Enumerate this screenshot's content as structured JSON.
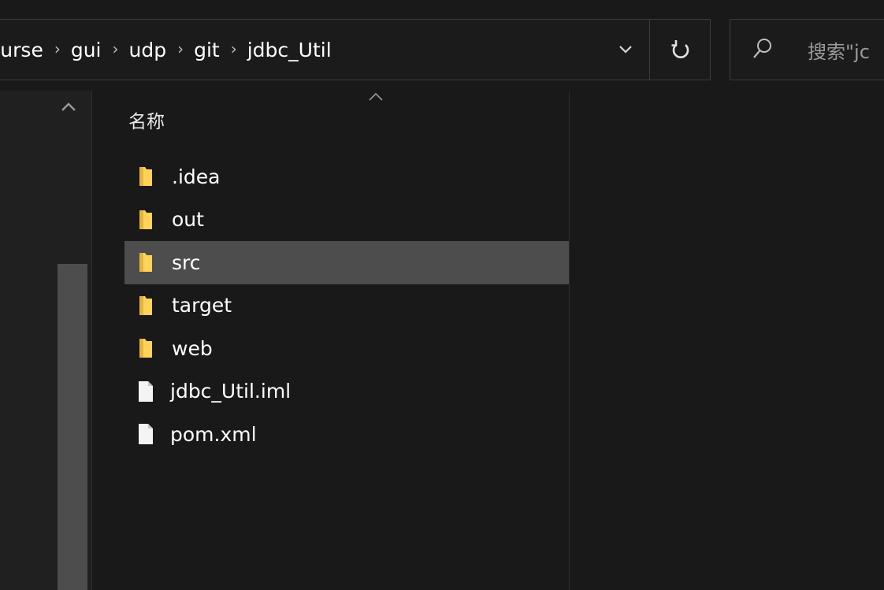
{
  "address_bar": {
    "breadcrumbs": [
      "ourse",
      "gui",
      "udp",
      "git",
      "jdbc_Util"
    ],
    "dropdown_icon": "chevron-down-icon",
    "refresh_icon": "refresh-icon"
  },
  "search": {
    "placeholder": "搜索\"jdbc_Util\"",
    "visible_text": "搜索\"jc",
    "icon": "search-icon"
  },
  "nav_pane": {
    "scroll_up_icon": "chevron-up-icon"
  },
  "file_list": {
    "column_header": "名称",
    "sort_icon": "sort-ascending-icon",
    "items": [
      {
        "name": ".idea",
        "type": "folder",
        "selected": false
      },
      {
        "name": "out",
        "type": "folder",
        "selected": false
      },
      {
        "name": "src",
        "type": "folder",
        "selected": true
      },
      {
        "name": "target",
        "type": "folder",
        "selected": false
      },
      {
        "name": "web",
        "type": "folder",
        "selected": false
      },
      {
        "name": "jdbc_Util.iml",
        "type": "file",
        "selected": false
      },
      {
        "name": "pom.xml",
        "type": "file",
        "selected": false
      }
    ]
  },
  "colors": {
    "background": "#191919",
    "selection": "#4d4d4d",
    "folder": "#ffd25a",
    "border": "#3c3c3c"
  }
}
